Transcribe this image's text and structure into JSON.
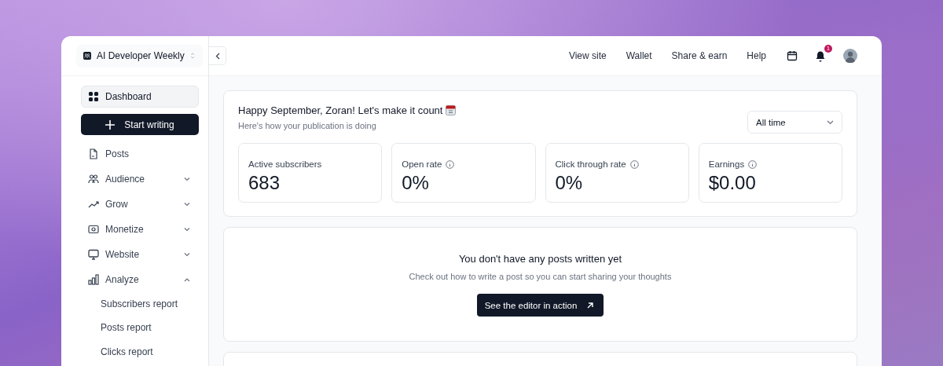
{
  "publication": {
    "name": "AI Developer Weekly"
  },
  "top_nav": [
    {
      "label": "View site"
    },
    {
      "label": "Wallet"
    },
    {
      "label": "Share & earn"
    },
    {
      "label": "Help"
    }
  ],
  "notifications": {
    "count": "1"
  },
  "sidebar": {
    "items": [
      {
        "label": "Dashboard",
        "kind": "link",
        "selected": true
      },
      {
        "label": "Start writing",
        "kind": "action"
      },
      {
        "label": "Posts",
        "kind": "link",
        "selected": false
      },
      {
        "label": "Audience",
        "kind": "group",
        "selected": false,
        "expanded": false
      },
      {
        "label": "Grow",
        "kind": "group",
        "selected": false,
        "expanded": false
      },
      {
        "label": "Monetize",
        "kind": "group",
        "selected": false,
        "expanded": false
      },
      {
        "label": "Website",
        "kind": "group",
        "selected": false,
        "expanded": false
      },
      {
        "label": "Analyze",
        "kind": "group",
        "selected": false,
        "expanded": true,
        "children": [
          {
            "label": "Subscribers report",
            "selected": false
          },
          {
            "label": "Posts report",
            "selected": false
          },
          {
            "label": "Clicks report",
            "selected": false
          }
        ]
      }
    ]
  },
  "overview": {
    "greeting": "Happy September, Zoran! Let's make it count",
    "subtitle": "Here's how your publication is doing",
    "period": {
      "value": "All time"
    },
    "stats": [
      {
        "label": "Active subscribers",
        "value": "683",
        "info": false
      },
      {
        "label": "Open rate",
        "value": "0%",
        "info": true
      },
      {
        "label": "Click through rate",
        "value": "0%",
        "info": true
      },
      {
        "label": "Earnings",
        "value": "$0.00",
        "info": true
      }
    ]
  },
  "empty_state": {
    "title": "You don't have any posts written yet",
    "text": "Check out how to write a post so you can start sharing your thoughts",
    "button": "See the editor in action"
  }
}
